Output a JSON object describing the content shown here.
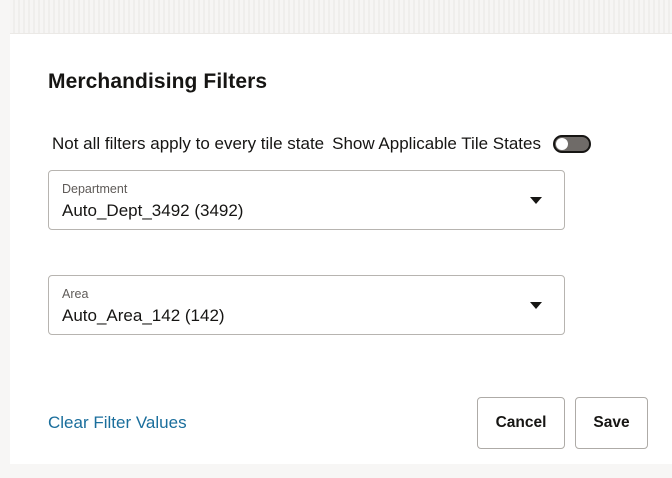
{
  "dialog": {
    "title": "Merchandising Filters",
    "info_text": "Not all filters apply to every tile state",
    "toggle_label": "Show Applicable Tile States",
    "toggle_on": false
  },
  "fields": {
    "department": {
      "label": "Department",
      "value": "Auto_Dept_3492 (3492)"
    },
    "area": {
      "label": "Area",
      "value": "Auto_Area_142 (142)"
    }
  },
  "footer": {
    "clear_label": "Clear Filter Values",
    "cancel_label": "Cancel",
    "save_label": "Save"
  },
  "colors": {
    "link": "#1a6e9c",
    "text": "#161513",
    "toggle_off": "#6f6b68"
  },
  "icons": {
    "dropdown": "caret-down-icon"
  }
}
